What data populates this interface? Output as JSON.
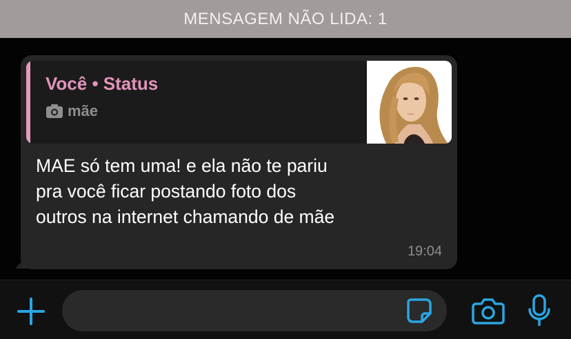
{
  "unread_banner": {
    "text": "MENSAGEM NÃO LIDA: 1"
  },
  "message": {
    "reply": {
      "title": "Você • Status",
      "caption": "mãe",
      "caption_icon": "camera-icon",
      "accent_color": "#e294bb"
    },
    "lines": [
      "MAE só tem uma! e ela não te pariu",
      "pra você ficar postando foto dos",
      "outros na internet chamando de mãe"
    ],
    "time": "19:04"
  },
  "composer": {
    "input_value": "",
    "icons": [
      "plus-icon",
      "sticker-icon",
      "camera-icon",
      "microphone-icon"
    ],
    "accent_color": "#2aa6e3"
  }
}
